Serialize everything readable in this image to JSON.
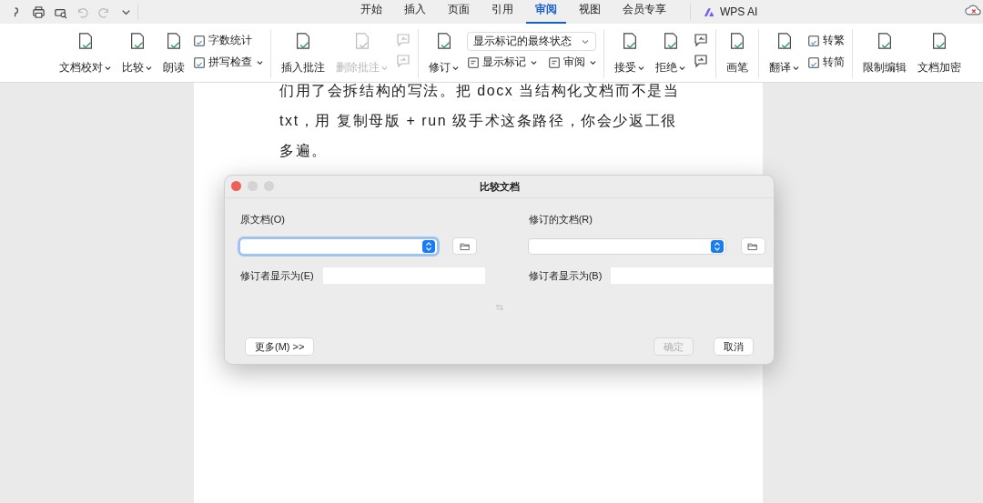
{
  "tabs": [
    {
      "label": "开始",
      "selected": false
    },
    {
      "label": "插入",
      "selected": false
    },
    {
      "label": "页面",
      "selected": false
    },
    {
      "label": "引用",
      "selected": false
    },
    {
      "label": "审阅",
      "selected": true
    },
    {
      "label": "视图",
      "selected": false
    },
    {
      "label": "会员专享",
      "selected": false
    }
  ],
  "ai_button": "WPS AI",
  "ribbon": [
    {
      "items": [
        {
          "kind": "large",
          "label": "文档校对",
          "dropdown": true,
          "disabled": false
        },
        {
          "kind": "large",
          "label": "比较",
          "dropdown": true,
          "disabled": false
        },
        {
          "kind": "large",
          "label": "朗读",
          "dropdown": false,
          "disabled": false
        },
        {
          "kind": "stack",
          "rows": [
            {
              "label": "字数统计",
              "dropdown": false,
              "disabled": false
            },
            {
              "label": "拼写检查",
              "dropdown": true,
              "disabled": false
            }
          ]
        }
      ]
    },
    {
      "items": [
        {
          "kind": "large",
          "label": "插入批注",
          "dropdown": false,
          "disabled": false
        },
        {
          "kind": "large",
          "label": "删除批注",
          "dropdown": true,
          "disabled": true
        },
        {
          "kind": "icons",
          "rows": [
            {
              "disabled": true
            },
            {
              "disabled": true
            }
          ]
        }
      ]
    },
    {
      "items": [
        {
          "kind": "large",
          "label": "修订",
          "dropdown": true,
          "disabled": false
        },
        {
          "kind": "markup",
          "select": "显示标记的最终状态",
          "rows": [
            {
              "label": "显示标记",
              "dropdown": true,
              "disabled": false
            },
            {
              "label": "审阅",
              "dropdown": true,
              "disabled": false
            }
          ]
        }
      ]
    },
    {
      "items": [
        {
          "kind": "large",
          "label": "接受",
          "dropdown": true,
          "disabled": false
        },
        {
          "kind": "large",
          "label": "拒绝",
          "dropdown": true,
          "disabled": false
        },
        {
          "kind": "icons",
          "rows": [
            {
              "disabled": false
            },
            {
              "disabled": false
            }
          ]
        }
      ]
    },
    {
      "items": [
        {
          "kind": "large",
          "label": "画笔",
          "dropdown": false,
          "disabled": false
        }
      ]
    },
    {
      "items": [
        {
          "kind": "large",
          "label": "翻译",
          "dropdown": true,
          "disabled": false
        },
        {
          "kind": "stack",
          "rows": [
            {
              "label": "转繁",
              "dropdown": false,
              "disabled": false
            },
            {
              "label": "转简",
              "dropdown": false,
              "disabled": false
            }
          ]
        }
      ]
    },
    {
      "items": [
        {
          "kind": "large",
          "label": "限制编辑",
          "dropdown": false,
          "disabled": false
        },
        {
          "kind": "large",
          "label": "文档加密",
          "dropdown": false,
          "disabled": false
        }
      ]
    }
  ],
  "document": {
    "paragraphs": [
      {
        "lines": [
          "们用了会拆结构的写法。把 docx 当结构化文档而不是当",
          "txt，用 复制母版 + run 级手术这条路径，你会少返工很",
          "多遍。"
        ]
      }
    ]
  },
  "dialog": {
    "title": "比较文档",
    "original": {
      "label": "原文档(O)",
      "focused": true,
      "reviser_label": "修订者显示为(E)"
    },
    "revised": {
      "label": "修订的文档(R)",
      "focused": false,
      "reviser_label": "修订者显示为(B)"
    },
    "more_button": "更多(M) >>",
    "ok_button": {
      "label": "确定",
      "disabled": true
    },
    "cancel_button": {
      "label": "取消",
      "disabled": false
    }
  }
}
